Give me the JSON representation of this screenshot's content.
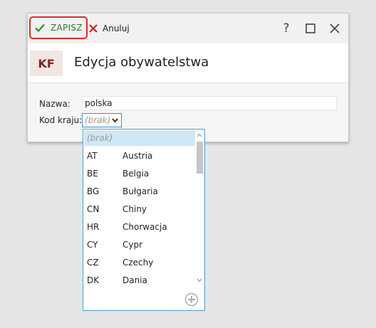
{
  "toolbar": {
    "save_label": "ZAPISZ",
    "cancel_label": "Anuluj",
    "help_label": "?"
  },
  "header": {
    "badge": "KF",
    "title": "Edycja obywatelstwa"
  },
  "form": {
    "name_label": "Nazwa:",
    "name_value": "polska",
    "country_label": "Kod kraju:",
    "country_value": "(brak)"
  },
  "dropdown": {
    "empty_option": "(brak)",
    "options": [
      {
        "code": "AT",
        "name": "Austria"
      },
      {
        "code": "BE",
        "name": "Belgia"
      },
      {
        "code": "BG",
        "name": "Bułgaria"
      },
      {
        "code": "CN",
        "name": "Chiny"
      },
      {
        "code": "HR",
        "name": "Chorwacja"
      },
      {
        "code": "CY",
        "name": "Cypr"
      },
      {
        "code": "CZ",
        "name": "Czechy"
      },
      {
        "code": "DK",
        "name": "Dania"
      }
    ]
  },
  "colors": {
    "accent_highlight": "#e02b2b",
    "save_green": "#2f7a2f",
    "badge_bg": "#f2e6e3",
    "badge_text": "#7a2b20",
    "selection_blue": "#cde8f6",
    "focus_border": "#3a8fd0"
  }
}
